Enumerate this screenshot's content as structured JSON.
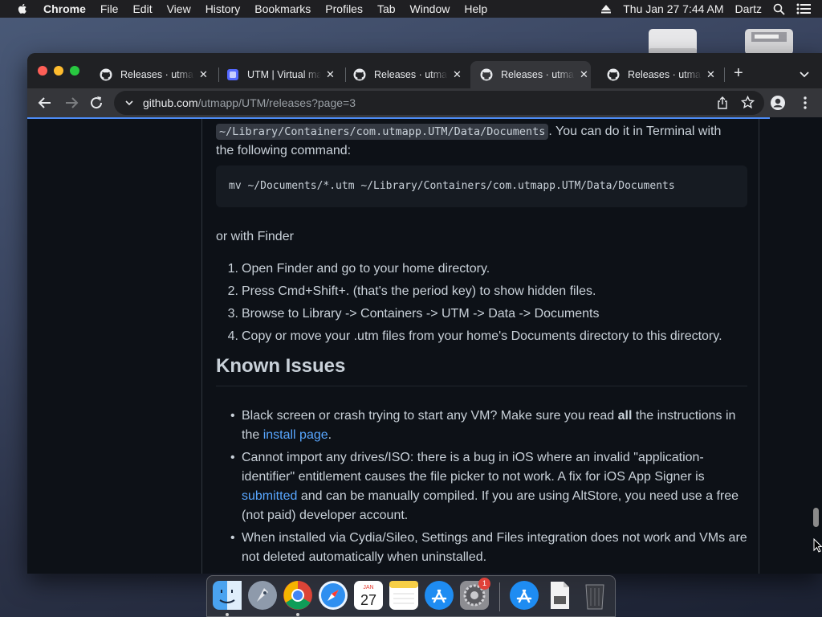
{
  "menubar": {
    "app": "Chrome",
    "items": [
      "File",
      "Edit",
      "View",
      "History",
      "Bookmarks",
      "Profiles",
      "Tab",
      "Window",
      "Help"
    ],
    "datetime": "Thu Jan 27  7:44 AM",
    "user": "Dartz"
  },
  "tabs": [
    {
      "title": "Releases · utmapp/UTM",
      "icon": "github-icon"
    },
    {
      "title": "UTM | Virtual machines",
      "icon": "utm-icon"
    },
    {
      "title": "Releases · utmapp/UTM",
      "icon": "github-icon"
    },
    {
      "title": "Releases · utmapp/UTM",
      "icon": "github-icon",
      "active": true
    },
    {
      "title": "Releases · utmapp/UTM",
      "icon": "github-icon"
    }
  ],
  "omnibox": {
    "host": "github.com",
    "path": "/utmapp/UTM/releases?page=3"
  },
  "content": {
    "p1_code": "~/Library/Containers/com.utmapp.UTM/Data/Documents",
    "p1_text_a": ". You can do it in Terminal with",
    "p1_text_b": "the following command:",
    "command": "mv ~/Documents/*.utm ~/Library/Containers/com.utmapp.UTM/Data/Documents",
    "p2": "or with Finder",
    "steps": [
      "Open Finder and go to your home directory.",
      "Press Cmd+Shift+. (that's the period key) to show hidden files.",
      "Browse to Library -> Containers -> UTM -> Data -> Documents",
      "Copy or move your .utm files from your home's Documents directory to this directory."
    ],
    "heading": "Known Issues",
    "issue1_a": "Black screen or crash trying to start any VM? Make sure you read ",
    "issue1_bold": "all",
    "issue1_b": " the instructions in the ",
    "issue1_link": "install page",
    "issue1_c": ".",
    "issue2_a": "Cannot import any drives/ISO: there is a bug in iOS where an invalid \"application-identifier\" entitlement causes the file picker to not work. A fix for iOS App Signer is ",
    "issue2_link": "submitted",
    "issue2_b": " and can be manually compiled. If you are using AltStore, you need use a free (not paid) developer account.",
    "issue3": "When installed via Cydia/Sileo, Settings and Files integration does not work and VMs are not deleted automatically when uninstalled."
  },
  "dock": {
    "apps": [
      "finder-icon",
      "launchpad-icon",
      "chrome-icon",
      "safari-icon",
      "calendar-icon",
      "notes-icon",
      "app-store-icon",
      "system-preferences-icon",
      "app-store-downloads-icon",
      "file-icon",
      "trash-icon"
    ],
    "calendar_month": "JAN",
    "calendar_day": "27",
    "badge": "1"
  },
  "colors": {
    "page_bg": "#0d1117",
    "text": "#c9d1d9",
    "link": "#58a6ff",
    "progress": "#4c8bf5"
  }
}
